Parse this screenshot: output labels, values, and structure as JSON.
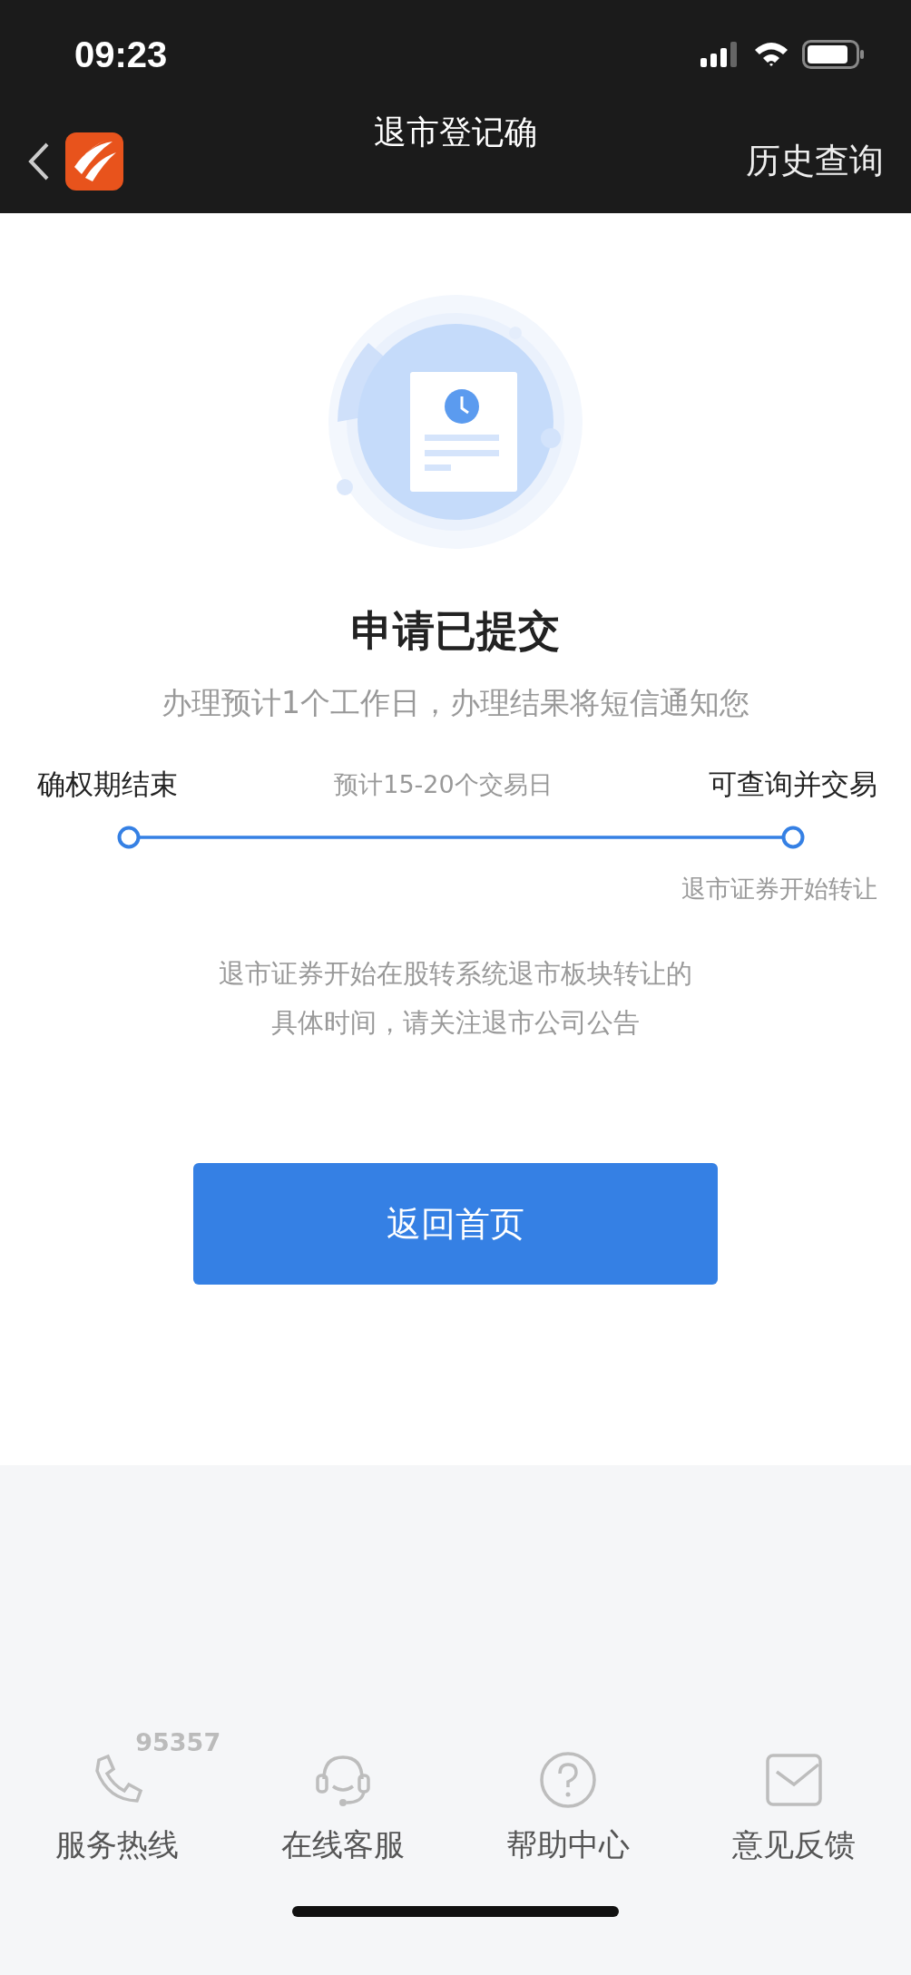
{
  "status_bar": {
    "time": "09:23"
  },
  "nav": {
    "title": "退市登记确",
    "action": "历史查询"
  },
  "result": {
    "title": "申请已提交",
    "subtitle": "办理预计1个工作日，办理结果将短信通知您"
  },
  "timeline": {
    "start_label": "确权期结束",
    "duration": "预计15-20个交易日",
    "end_label": "可查询并交易",
    "end_note": "退市证券开始转让"
  },
  "notice": [
    "退市证券开始在股转系统退市板块转让的",
    "具体时间，请关注退市公司公告"
  ],
  "primary_button": "返回首页",
  "footer": [
    {
      "kind": "phone",
      "label": "服务热线",
      "badge": "95357"
    },
    {
      "kind": "headset",
      "label": "在线客服"
    },
    {
      "kind": "help",
      "label": "帮助中心"
    },
    {
      "kind": "mail",
      "label": "意见反馈"
    }
  ]
}
